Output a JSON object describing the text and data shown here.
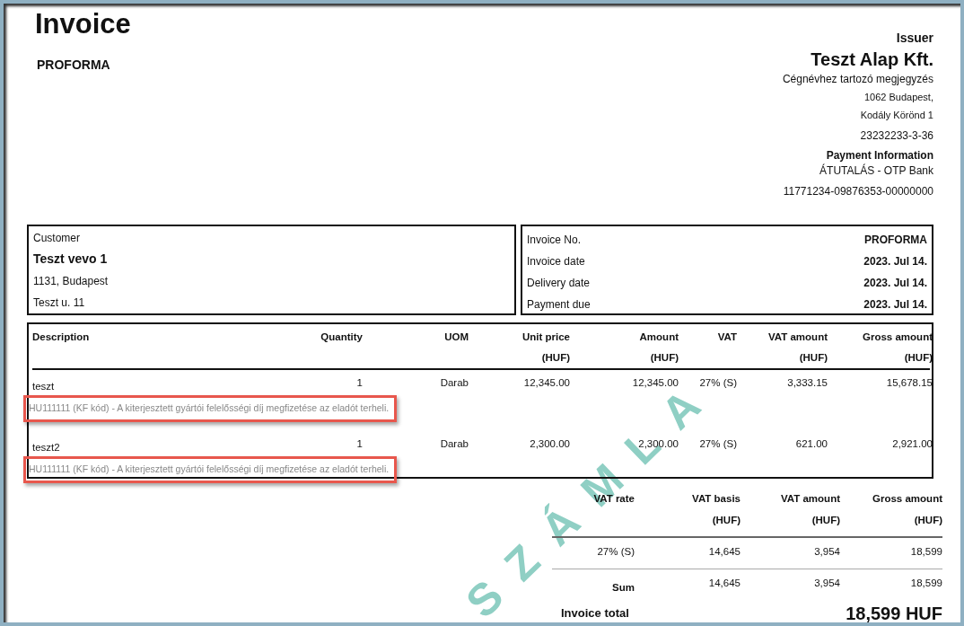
{
  "title": "Invoice",
  "subtitle": "PROFORMA",
  "watermark": "SZÁMLA",
  "issuer": {
    "heading": "Issuer",
    "name": "Teszt Alap Kft.",
    "note": "Cégnévhez tartozó megjegyzés",
    "address": [
      "1062 Budapest,",
      "Kodály Körönd 1"
    ],
    "tax_number": "23232233-3-36",
    "payment_heading": "Payment Information",
    "payment_method": "ÁTUTALÁS - OTP Bank",
    "account_number": "11771234-09876353-00000000"
  },
  "customer": {
    "label": "Customer",
    "name": "Teszt vevo 1",
    "address": [
      "1131, Budapest",
      "Teszt u. 11"
    ]
  },
  "invoice_info": [
    {
      "label": "Invoice No.",
      "value": "PROFORMA"
    },
    {
      "label": "Invoice date",
      "value": "2023. Jul 14."
    },
    {
      "label": "Delivery date",
      "value": "2023. Jul 14."
    },
    {
      "label": "Payment due",
      "value": "2023. Jul 14."
    }
  ],
  "items": {
    "columns": [
      {
        "heading": "Description"
      },
      {
        "heading": "Quantity"
      },
      {
        "heading": "UOM"
      },
      {
        "heading": "Unit price",
        "unit": "(HUF)"
      },
      {
        "heading": "Amount",
        "unit": "(HUF)"
      },
      {
        "heading": "VAT"
      },
      {
        "heading": "VAT amount",
        "unit": "(HUF)"
      },
      {
        "heading": "Gross amount",
        "unit": "(HUF)"
      }
    ],
    "rows": [
      {
        "cells": [
          "teszt",
          "1",
          "Darab",
          "12,345.00",
          "12,345.00",
          "27% (S)",
          "3,333.15",
          "15,678.15"
        ],
        "note": "HU111111 (KF kód) - A kiterjesztett gyártói felelősségi díj megfizetése az eladót terheli.",
        "highlighted": true
      },
      {
        "cells": [
          "teszt2",
          "1",
          "Darab",
          "2,300.00",
          "2,300.00",
          "27% (S)",
          "621.00",
          "2,921.00"
        ],
        "note": "HU111111 (KF kód) - A kiterjesztett gyártói felelősségi díj megfizetése az eladót terheli.",
        "highlighted": true
      }
    ]
  },
  "vat_summary": {
    "columns": [
      {
        "heading": "VAT rate"
      },
      {
        "heading": "VAT basis",
        "unit": "(HUF)"
      },
      {
        "heading": "VAT amount",
        "unit": "(HUF)"
      },
      {
        "heading": "Gross amount",
        "unit": "(HUF)"
      }
    ],
    "rows": [
      {
        "kind": "rate",
        "cells": [
          "27% (S)",
          "14,645",
          "3,954",
          "18,599"
        ]
      },
      {
        "kind": "sum",
        "cells": [
          "Sum",
          "14,645",
          "3,954",
          "18,599"
        ]
      }
    ]
  },
  "total": {
    "label": "Invoice total",
    "value": "18,599 HUF"
  }
}
